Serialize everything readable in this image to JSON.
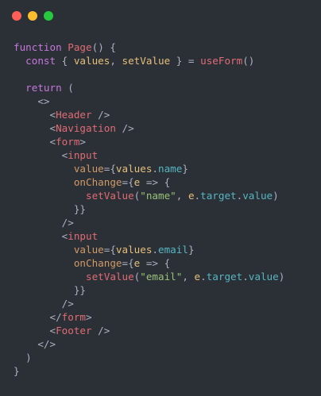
{
  "window": {
    "controls": {
      "close_color": "#ff5f56",
      "minimize_color": "#ffbd2e",
      "maximize_color": "#27c93f"
    }
  },
  "colors": {
    "background": "#2b2f36",
    "keyword": "#c678dd",
    "function": "#e06c75",
    "tag": "#e06c75",
    "attr": "#d19a66",
    "prop": "#56b6c2",
    "string": "#98c379",
    "punct": "#abb2bf",
    "ident": "#e5c07b"
  },
  "code_lines": [
    [
      {
        "t": "function",
        "k": "keyword"
      },
      {
        "t": " ",
        "k": "punct"
      },
      {
        "t": "Page",
        "k": "function"
      },
      {
        "t": "() {",
        "k": "punct"
      }
    ],
    [
      {
        "t": "  ",
        "k": "punct"
      },
      {
        "t": "const",
        "k": "keyword"
      },
      {
        "t": " { ",
        "k": "punct"
      },
      {
        "t": "values",
        "k": "ident"
      },
      {
        "t": ", ",
        "k": "punct"
      },
      {
        "t": "setValue",
        "k": "ident"
      },
      {
        "t": " } = ",
        "k": "punct"
      },
      {
        "t": "useForm",
        "k": "function"
      },
      {
        "t": "()",
        "k": "punct"
      }
    ],
    [],
    [
      {
        "t": "  ",
        "k": "punct"
      },
      {
        "t": "return",
        "k": "keyword"
      },
      {
        "t": " (",
        "k": "punct"
      }
    ],
    [
      {
        "t": "    <>",
        "k": "punct"
      }
    ],
    [
      {
        "t": "      <",
        "k": "punct"
      },
      {
        "t": "Header",
        "k": "tag"
      },
      {
        "t": " />",
        "k": "punct"
      }
    ],
    [
      {
        "t": "      <",
        "k": "punct"
      },
      {
        "t": "Navigation",
        "k": "tag"
      },
      {
        "t": " />",
        "k": "punct"
      }
    ],
    [
      {
        "t": "      <",
        "k": "punct"
      },
      {
        "t": "form",
        "k": "tag"
      },
      {
        "t": ">",
        "k": "punct"
      }
    ],
    [
      {
        "t": "        <",
        "k": "punct"
      },
      {
        "t": "input",
        "k": "tag"
      }
    ],
    [
      {
        "t": "          ",
        "k": "punct"
      },
      {
        "t": "value",
        "k": "attr"
      },
      {
        "t": "={",
        "k": "punct"
      },
      {
        "t": "values",
        "k": "ident"
      },
      {
        "t": ".",
        "k": "punct"
      },
      {
        "t": "name",
        "k": "prop"
      },
      {
        "t": "}",
        "k": "punct"
      }
    ],
    [
      {
        "t": "          ",
        "k": "punct"
      },
      {
        "t": "onChange",
        "k": "attr"
      },
      {
        "t": "={",
        "k": "punct"
      },
      {
        "t": "e",
        "k": "ident"
      },
      {
        "t": " => {",
        "k": "punct"
      }
    ],
    [
      {
        "t": "            ",
        "k": "punct"
      },
      {
        "t": "setValue",
        "k": "function"
      },
      {
        "t": "(",
        "k": "punct"
      },
      {
        "t": "\"name\"",
        "k": "string"
      },
      {
        "t": ", ",
        "k": "punct"
      },
      {
        "t": "e",
        "k": "ident"
      },
      {
        "t": ".",
        "k": "punct"
      },
      {
        "t": "target",
        "k": "prop"
      },
      {
        "t": ".",
        "k": "punct"
      },
      {
        "t": "value",
        "k": "prop"
      },
      {
        "t": ")",
        "k": "punct"
      }
    ],
    [
      {
        "t": "          }}",
        "k": "punct"
      }
    ],
    [
      {
        "t": "        />",
        "k": "punct"
      }
    ],
    [
      {
        "t": "        <",
        "k": "punct"
      },
      {
        "t": "input",
        "k": "tag"
      }
    ],
    [
      {
        "t": "          ",
        "k": "punct"
      },
      {
        "t": "value",
        "k": "attr"
      },
      {
        "t": "={",
        "k": "punct"
      },
      {
        "t": "values",
        "k": "ident"
      },
      {
        "t": ".",
        "k": "punct"
      },
      {
        "t": "email",
        "k": "prop"
      },
      {
        "t": "}",
        "k": "punct"
      }
    ],
    [
      {
        "t": "          ",
        "k": "punct"
      },
      {
        "t": "onChange",
        "k": "attr"
      },
      {
        "t": "={",
        "k": "punct"
      },
      {
        "t": "e",
        "k": "ident"
      },
      {
        "t": " => {",
        "k": "punct"
      }
    ],
    [
      {
        "t": "            ",
        "k": "punct"
      },
      {
        "t": "setValue",
        "k": "function"
      },
      {
        "t": "(",
        "k": "punct"
      },
      {
        "t": "\"email\"",
        "k": "string"
      },
      {
        "t": ", ",
        "k": "punct"
      },
      {
        "t": "e",
        "k": "ident"
      },
      {
        "t": ".",
        "k": "punct"
      },
      {
        "t": "target",
        "k": "prop"
      },
      {
        "t": ".",
        "k": "punct"
      },
      {
        "t": "value",
        "k": "prop"
      },
      {
        "t": ")",
        "k": "punct"
      }
    ],
    [
      {
        "t": "          }}",
        "k": "punct"
      }
    ],
    [
      {
        "t": "        />",
        "k": "punct"
      }
    ],
    [
      {
        "t": "      </",
        "k": "punct"
      },
      {
        "t": "form",
        "k": "tag"
      },
      {
        "t": ">",
        "k": "punct"
      }
    ],
    [
      {
        "t": "      <",
        "k": "punct"
      },
      {
        "t": "Footer",
        "k": "tag"
      },
      {
        "t": " />",
        "k": "punct"
      }
    ],
    [
      {
        "t": "    </>",
        "k": "punct"
      }
    ],
    [
      {
        "t": "  )",
        "k": "punct"
      }
    ],
    [
      {
        "t": "}",
        "k": "punct"
      }
    ]
  ]
}
